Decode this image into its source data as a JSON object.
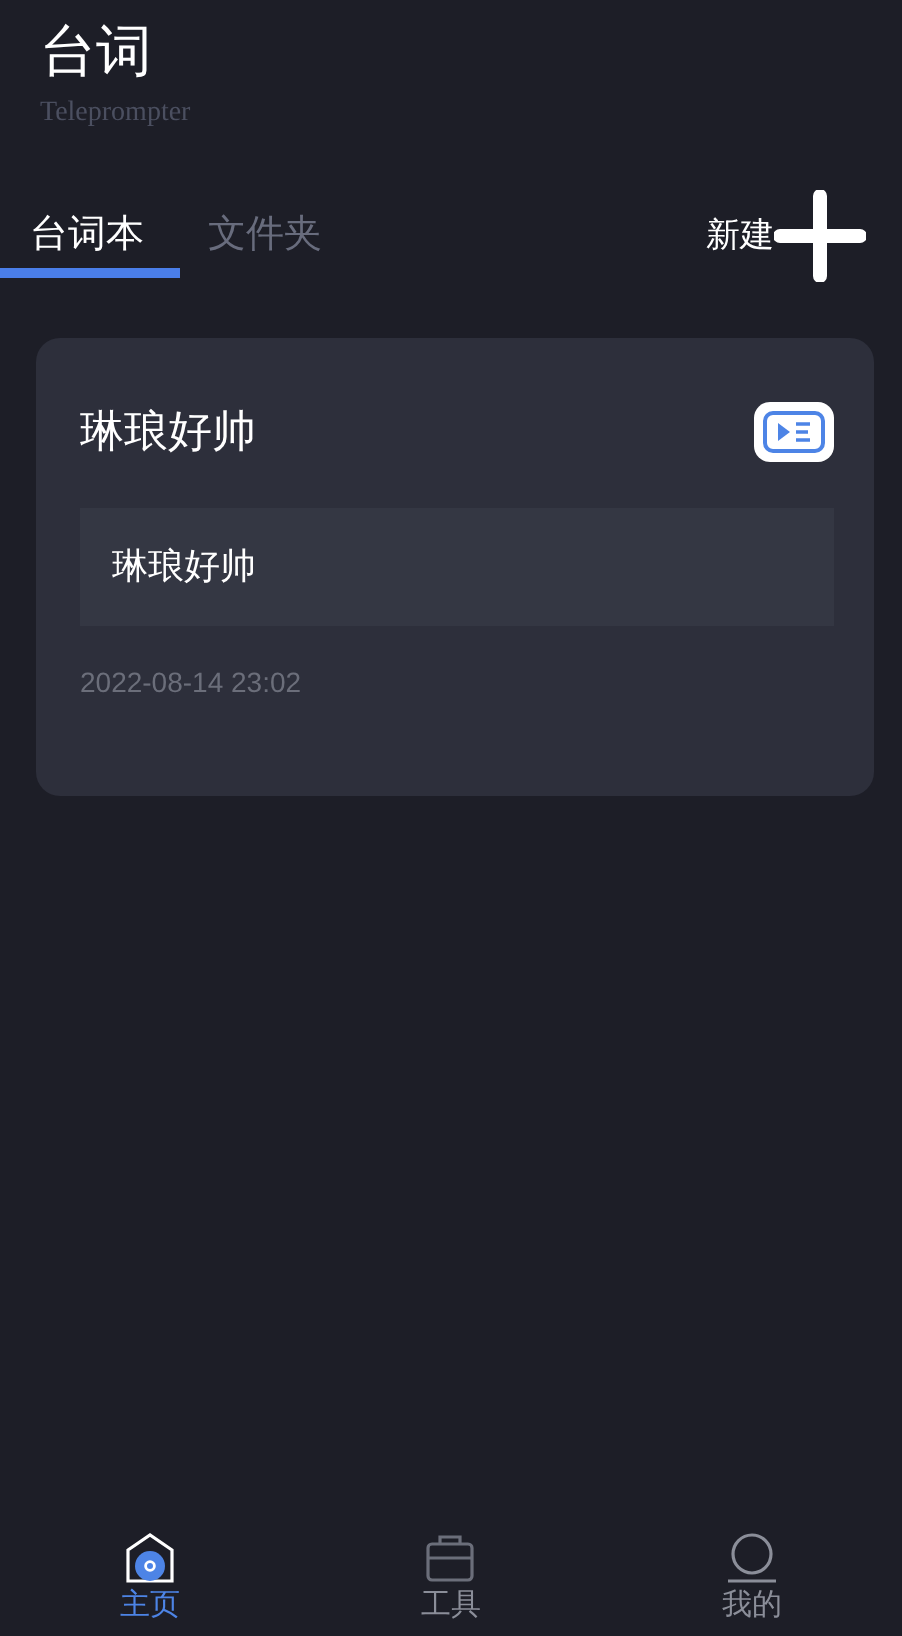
{
  "header": {
    "title": "台词",
    "subtitle": "Teleprompter"
  },
  "tabs": [
    {
      "label": "台词本",
      "selected": true
    },
    {
      "label": "文件夹",
      "selected": false
    }
  ],
  "new_button": {
    "label": "新建"
  },
  "scripts": [
    {
      "title": "琳琅好帅",
      "preview": "琳琅好帅",
      "date": "2022-08-14 23:02"
    }
  ],
  "bottom_nav": [
    {
      "label": "主页",
      "kind": "home",
      "selected": true
    },
    {
      "label": "工具",
      "kind": "tools",
      "selected": false
    },
    {
      "label": "我的",
      "kind": "profile",
      "selected": false
    }
  ]
}
